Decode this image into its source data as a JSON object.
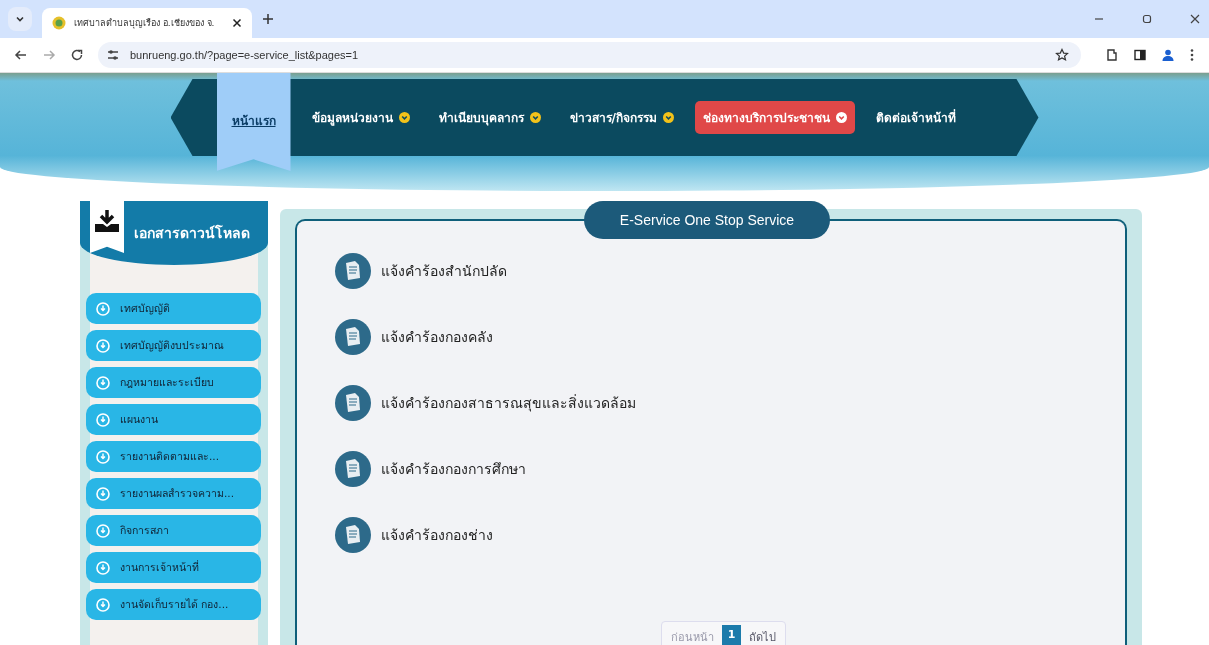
{
  "browser": {
    "tab_title": "เทศบาลตำบลบุญเรือง อ.เชียงของ จ.",
    "url": "bunrueng.go.th/?page=e-service_list&pages=1"
  },
  "nav": [
    {
      "label": "หน้าแรก",
      "selected": true,
      "highlighted": false,
      "has_menu": false
    },
    {
      "label": "ข้อมูลหน่วยงาน",
      "selected": false,
      "highlighted": false,
      "has_menu": true
    },
    {
      "label": "ทำเนียบบุคลากร",
      "selected": false,
      "highlighted": false,
      "has_menu": true
    },
    {
      "label": "ข่าวสาร/กิจกรรม",
      "selected": false,
      "highlighted": false,
      "has_menu": true
    },
    {
      "label": "ช่องทางบริการประชาชน",
      "selected": false,
      "highlighted": true,
      "has_menu": true
    },
    {
      "label": "ติดต่อเจ้าหน้าที่",
      "selected": false,
      "highlighted": false,
      "has_menu": false
    }
  ],
  "sidebar": {
    "title": "เอกสารดาวน์โหลด",
    "items": [
      "เทศบัญญัติ",
      "เทศบัญญัติงบประมาณ",
      "กฎหมายและระเบียบ",
      "แผนงาน",
      "รายงานติดตามและ...",
      "รายงานผลสำรวจความ...",
      "กิจการสภา",
      "งานการเจ้าหน้าที่",
      "งานจัดเก็บรายได้ กอง..."
    ]
  },
  "panel": {
    "title": "E-Service One Stop Service",
    "items": [
      "แจ้งคำร้องสำนักปลัด",
      "แจ้งคำร้องกองคลัง",
      "แจ้งคำร้องกองสาธารณสุขและสิ่งแวดล้อม",
      "แจ้งคำร้องกองการศึกษา",
      "แจ้งคำร้องกองช่าง"
    ]
  },
  "pagination": [
    {
      "label": "ก่อนหน้า",
      "selected": false,
      "disabled": true
    },
    {
      "label": "1",
      "selected": true,
      "disabled": false
    },
    {
      "label": "ถัดไป",
      "selected": false,
      "disabled": false
    }
  ]
}
